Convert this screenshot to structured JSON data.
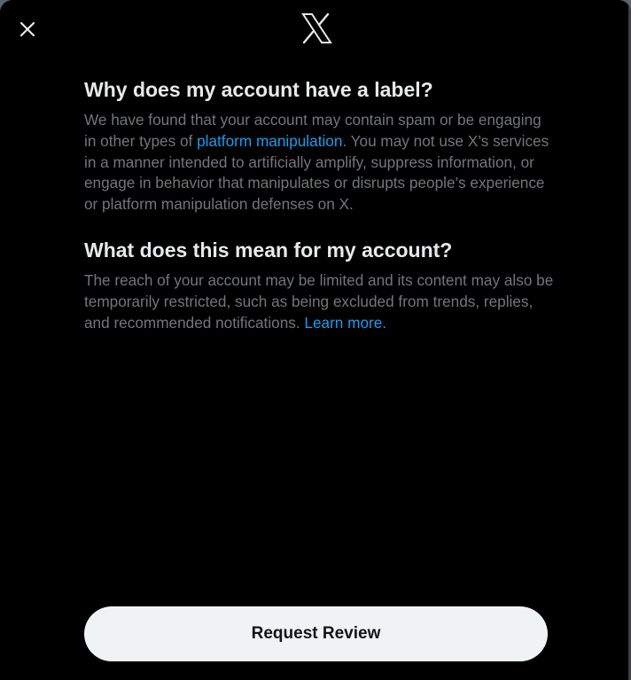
{
  "header": {
    "close_icon": "close-icon",
    "logo_icon": "x-logo-icon"
  },
  "section1": {
    "heading": "Why does my account have a label?",
    "text_before": "We have found that your account may contain spam or be engaging in other types of ",
    "link": "platform manipulation",
    "text_after": ". You may not use X’s services in a manner intended to artificially amplify, suppress information, or engage in behavior that manipulates or disrupts people’s experience or platform manipulation defenses on X."
  },
  "section2": {
    "heading": "What does this mean for my account?",
    "text": "The reach of your account may be limited and its content may also be temporarily restricted, such as being excluded from trends, replies, and recommended notifications. ",
    "link": "Learn more."
  },
  "footer": {
    "button_label": "Request Review"
  },
  "colors": {
    "background": "#000000",
    "heading": "#e7e9ea",
    "body_text": "#71767b",
    "link": "#1d9bf0",
    "button_bg": "#eff3f4",
    "button_text": "#0f1419"
  }
}
